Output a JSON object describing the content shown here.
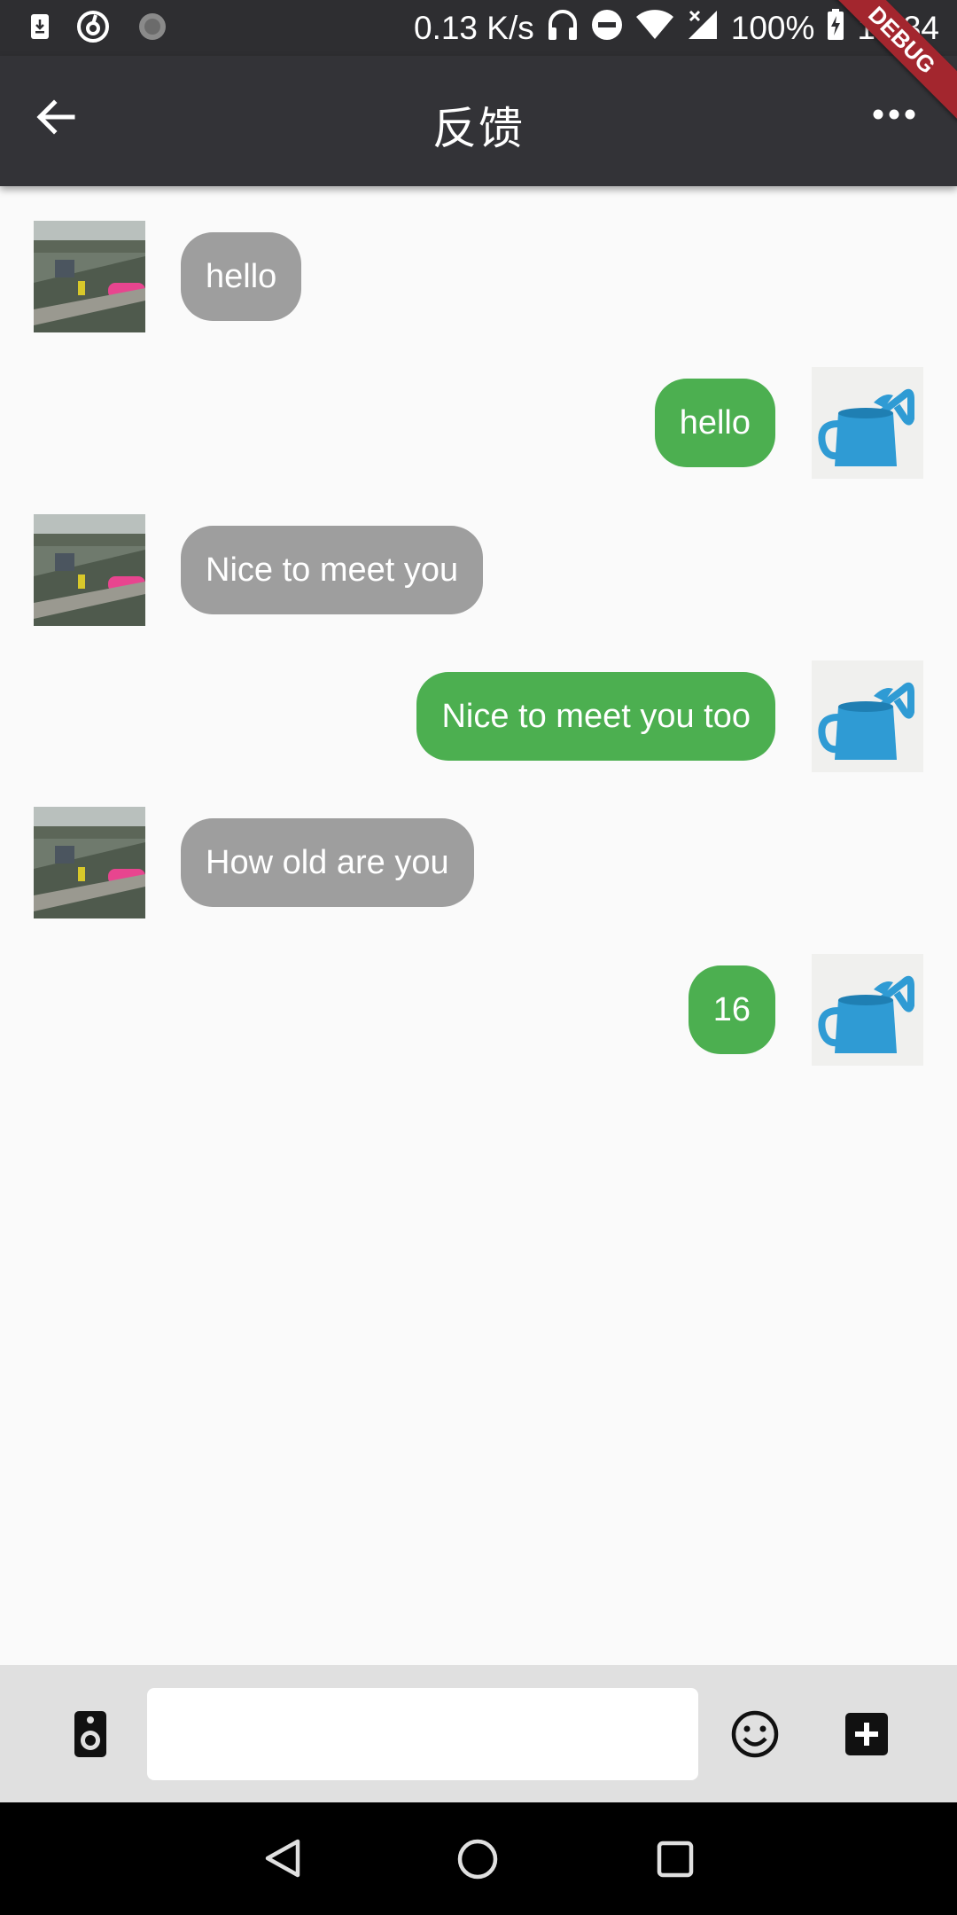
{
  "status_bar": {
    "net_speed": "0.13 K/s",
    "battery": "100%",
    "time": "14:34",
    "icons": [
      "download-notification-icon",
      "netease-music-icon",
      "loading-icon",
      "headphones-icon",
      "do-not-disturb-icon",
      "wifi-icon",
      "signal-icon",
      "battery-charging-icon"
    ]
  },
  "app_bar": {
    "title": "反馈",
    "debug_label": "DEBUG",
    "back_icon": "arrow-left-icon",
    "more_icon": "more-horiz-icon"
  },
  "messages": [
    {
      "from": "other",
      "text": "hello"
    },
    {
      "from": "self",
      "text": "hello"
    },
    {
      "from": "other",
      "text": "Nice to meet you"
    },
    {
      "from": "self",
      "text": "Nice to meet you too"
    },
    {
      "from": "other",
      "text": "How old are you"
    },
    {
      "from": "self",
      "text": "16"
    }
  ],
  "input_bar": {
    "value": "",
    "placeholder": "",
    "icons": [
      "speaker-icon",
      "emoji-icon",
      "add-box-icon"
    ]
  },
  "colors": {
    "app_bar": "#333337",
    "status_bar": "#2e2e31",
    "self_bubble": "#4caf50",
    "other_bubble": "#9e9e9e",
    "debug_ribbon": "#a3262e"
  }
}
